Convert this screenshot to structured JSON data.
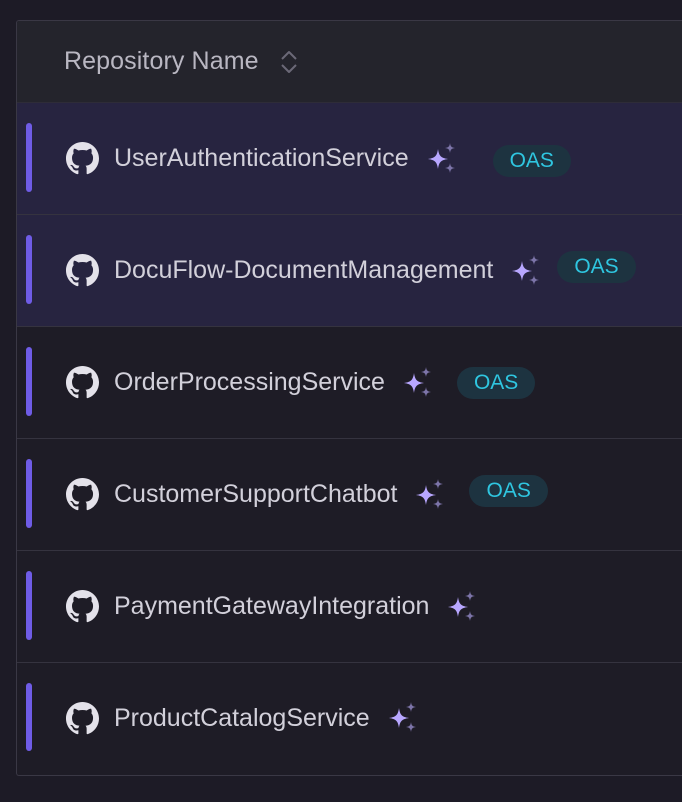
{
  "header": {
    "column_label": "Repository Name",
    "sort_icon": "sort-updown-icon"
  },
  "colors": {
    "accent": "#6f5ce6",
    "badge_text": "#2fc6e0",
    "sparkle": "#b8a7ff"
  },
  "rows": [
    {
      "name": "UserAuthenticationService",
      "badge": "OAS",
      "selected": true
    },
    {
      "name": "DocuFlow-DocumentManagement",
      "badge": "OAS",
      "selected": true
    },
    {
      "name": "OrderProcessingService",
      "badge": "OAS",
      "selected": false
    },
    {
      "name": "CustomerSupportChatbot",
      "badge": "OAS",
      "selected": false
    },
    {
      "name": "PaymentGatewayIntegration",
      "badge": "",
      "selected": false
    },
    {
      "name": "ProductCatalogService",
      "badge": "",
      "selected": false
    }
  ]
}
